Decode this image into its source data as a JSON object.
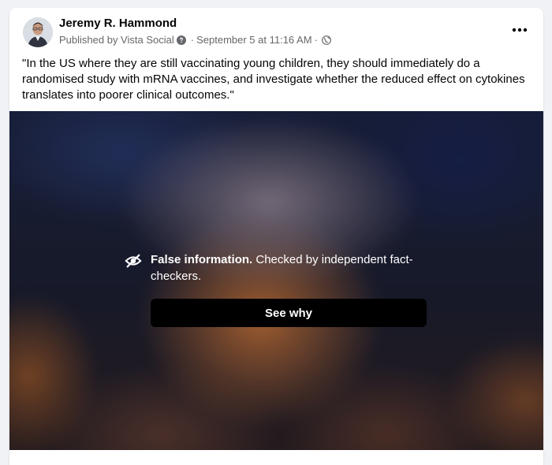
{
  "post": {
    "author": "Jeremy R. Hammond",
    "published_by": "Published by Vista Social",
    "separator": "·",
    "date": "September 5 at 11:16 AM",
    "audience_icon": "globe-icon",
    "info_icon": "question-mark-icon",
    "more_icon": "more-horizontal-icon",
    "text": "\"In the US where they are still vaccinating young children, they should immediately do a randomised study with mRNA vaccines, and investigate whether the reduced effect on cytokines translates into poorer clinical outcomes.\""
  },
  "media": {
    "warning_icon": "eye-slash-icon",
    "warning_label": "False information.",
    "warning_detail": " Checked by independent fact-checkers.",
    "see_why_label": "See why"
  },
  "colors": {
    "background": "#f0f2f5",
    "card": "#ffffff",
    "text_primary": "#050505",
    "text_secondary": "#65676b",
    "button_bg": "#000000"
  }
}
